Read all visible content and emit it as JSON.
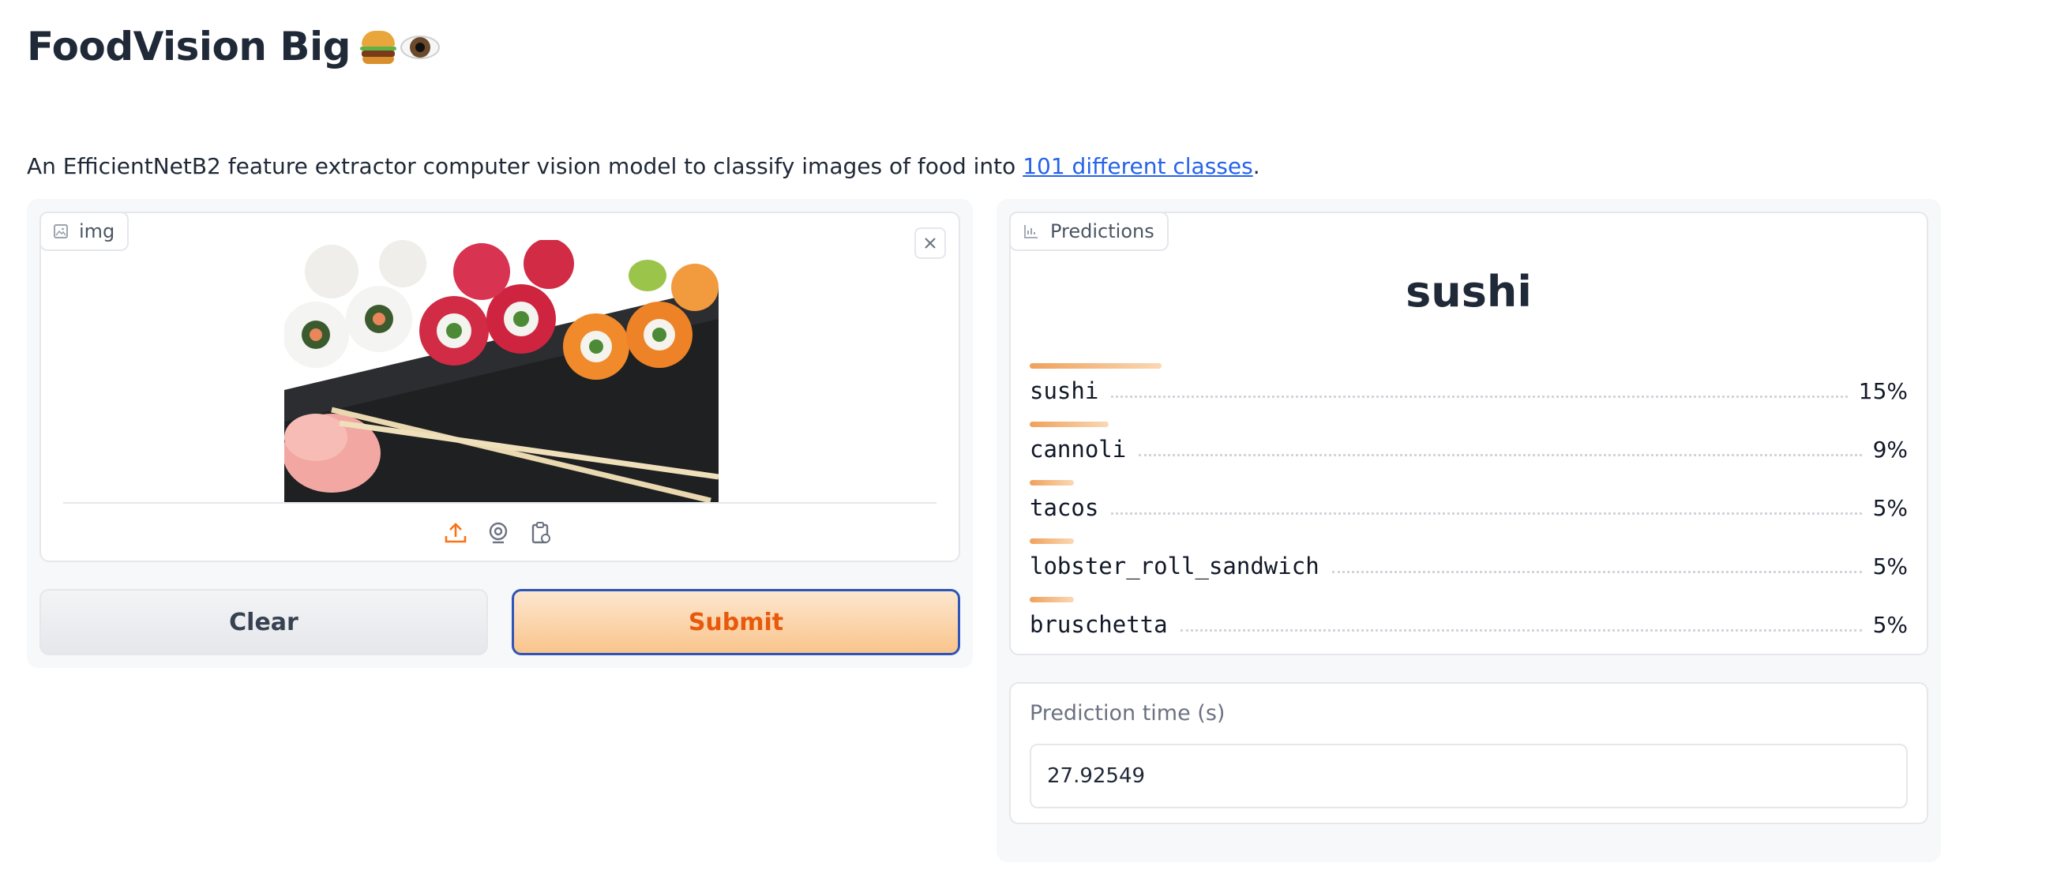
{
  "header": {
    "title": "FoodVision Big",
    "emoji_icons": [
      "hamburger-icon",
      "eye-icon"
    ]
  },
  "description": {
    "text_before": "An EfficientNetB2 feature extractor computer vision model to classify images of food into ",
    "link_text": "101 different classes",
    "text_after": "."
  },
  "input_image": {
    "label": "img",
    "label_icon": "image-icon",
    "clear_icon": "close-icon",
    "image_content": "photo of sushi rolls on a dark plate with pickled ginger and chopsticks",
    "tool_icons": [
      "upload-icon",
      "webcam-icon",
      "clipboard-icon"
    ]
  },
  "buttons": {
    "clear_label": "Clear",
    "submit_label": "Submit"
  },
  "predictions": {
    "label": "Predictions",
    "label_icon": "bar-chart-icon",
    "top_class": "sushi",
    "items": [
      {
        "name": "sushi",
        "percent": "15%",
        "confidence": 0.15
      },
      {
        "name": "cannoli",
        "percent": "9%",
        "confidence": 0.09
      },
      {
        "name": "tacos",
        "percent": "5%",
        "confidence": 0.05
      },
      {
        "name": "lobster_roll_sandwich",
        "percent": "5%",
        "confidence": 0.05
      },
      {
        "name": "bruschetta",
        "percent": "5%",
        "confidence": 0.05
      }
    ]
  },
  "prediction_time": {
    "label": "Prediction time (s)",
    "value": "27.92549"
  },
  "colors": {
    "accent_orange": "#e8590c",
    "link_blue": "#2563eb",
    "focus_blue": "#2f55b8"
  }
}
